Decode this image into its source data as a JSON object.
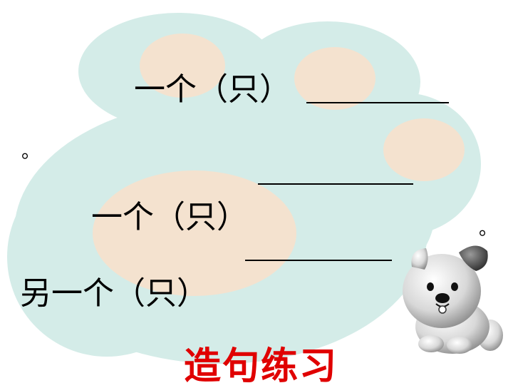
{
  "sentences": [
    {
      "text": "一个（只）"
    },
    {
      "text": "一个（只）"
    },
    {
      "text": "另一个（只）"
    }
  ],
  "punctuation": {
    "period": "。"
  },
  "title": {
    "text": "造句练习",
    "color": "#e00000"
  },
  "colors": {
    "cloud": "#d4ece8",
    "spot": "#f4e2cf"
  },
  "mascot": {
    "icon": "puppy-icon"
  }
}
